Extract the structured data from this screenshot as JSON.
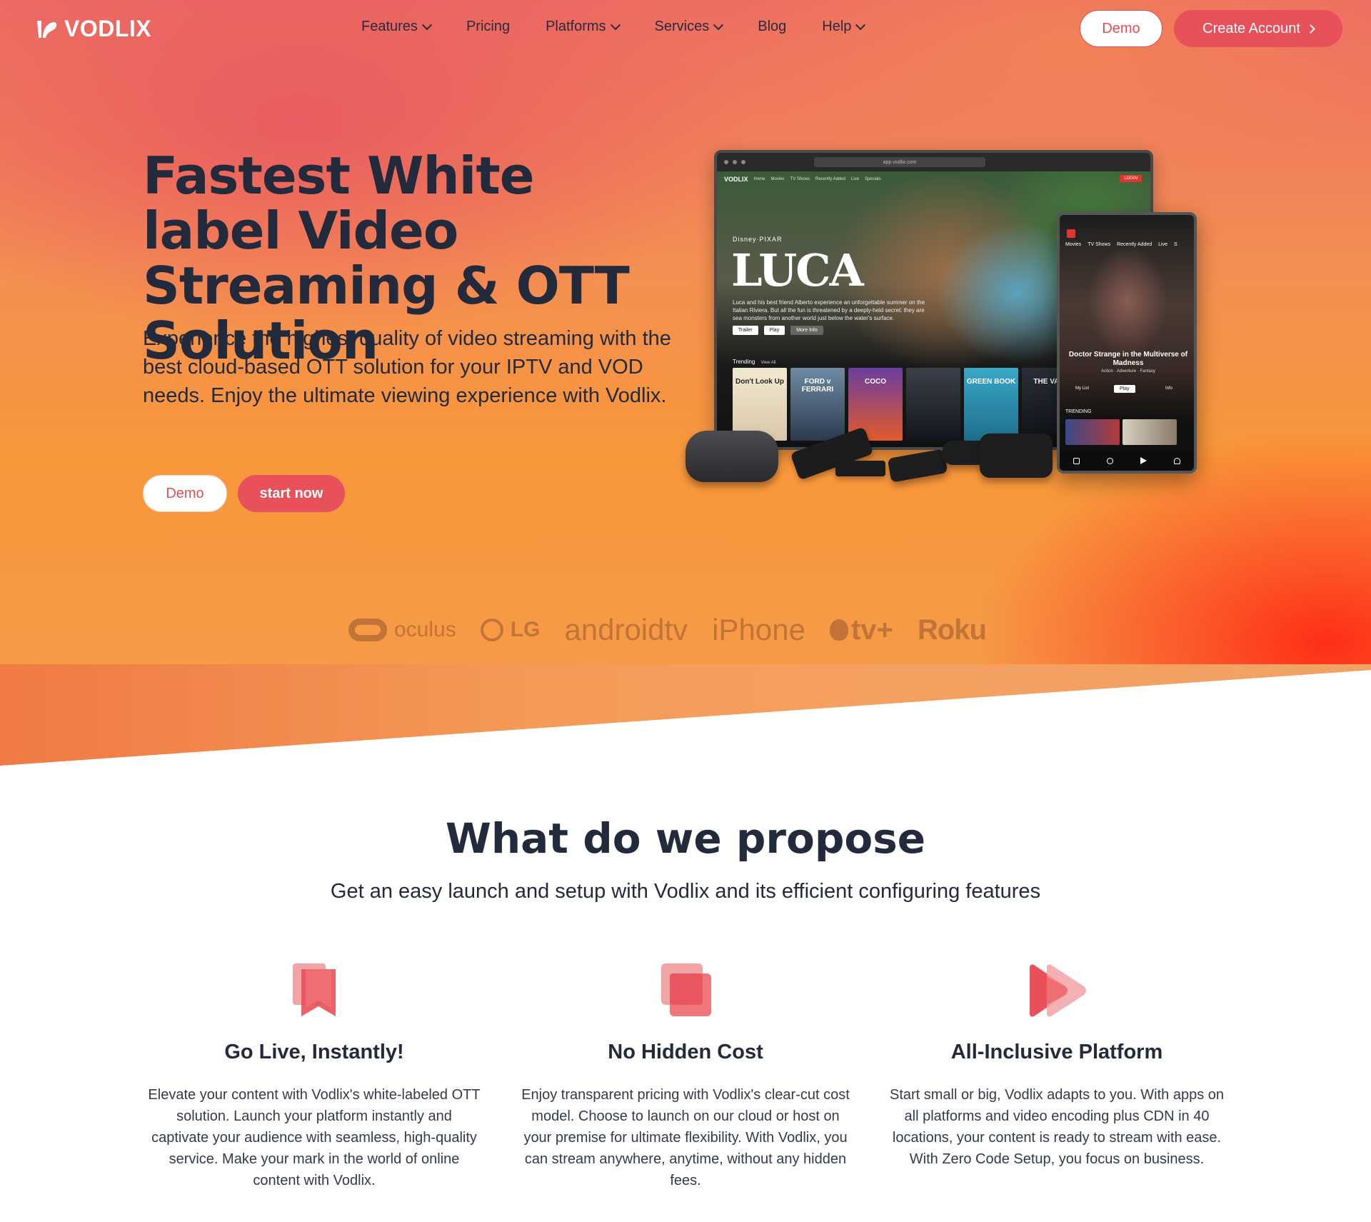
{
  "nav": {
    "brand": "VODLIX",
    "items": [
      {
        "label": "Features",
        "dropdown": true
      },
      {
        "label": "Pricing",
        "dropdown": false
      },
      {
        "label": "Platforms",
        "dropdown": true
      },
      {
        "label": "Services",
        "dropdown": true
      },
      {
        "label": "Blog",
        "dropdown": false
      },
      {
        "label": "Help",
        "dropdown": true
      }
    ],
    "demo_label": "Demo",
    "create_label": "Create Account"
  },
  "hero": {
    "title": "Fastest White label Video Streaming & OTT Solution",
    "subtitle": "Experience the highest quality of video streaming with the best cloud-based OTT solution for your IPTV and VOD needs. Enjoy the ultimate viewing experience with Vodlix.",
    "demo_label": "Demo",
    "start_label": "start now"
  },
  "mockup": {
    "url": "app.vodlix.com",
    "laptop_brand": "VODLIX",
    "laptop_nav": [
      "Home",
      "Movies",
      "TV Shows",
      "Recently Added",
      "Live",
      "Specials"
    ],
    "login": "LOGIN",
    "studio": "Disney·PIXAR",
    "feature_title": "LUCA",
    "feature_desc": "Luca and his best friend Alberto experience an unforgettable summer on the Italian Riviera. But all the fun is threatened by a deeply-held secret: they are sea monsters from another world just below the water's surface.",
    "buttons": [
      "Trailer",
      "Play",
      "More Info"
    ],
    "trending": "Trending",
    "view_all": "View All",
    "posters": [
      "Don't Look Up",
      "FORD v FERRARI",
      "COCO",
      "",
      "GREEN BOOK",
      "THE VAU"
    ],
    "tablet_nav": [
      "Movies",
      "TV Shows",
      "Recently Added",
      "Live",
      "S"
    ],
    "tablet_title": "Doctor Strange in the Multiverse of Madness",
    "tablet_genre": "Action · Adventure · Fantasy",
    "tablet_play": "Play",
    "tablet_mylist": "My List",
    "tablet_info": "Info",
    "tablet_trending": "TRENDING"
  },
  "platforms": [
    "oculus",
    "LG",
    "androidtv",
    "iPhone",
    "tv+",
    "Roku"
  ],
  "propose": {
    "title": "What do we propose",
    "subtitle": "Get an easy launch and setup with Vodlix and its efficient configuring features",
    "features": [
      {
        "icon": "bookmark-icon",
        "title": "Go Live, Instantly!",
        "text": "Elevate your content with Vodlix's white-labeled OTT solution. Launch your platform instantly and captivate your audience with seamless, high-quality service. Make your mark in the world of online content with Vodlix."
      },
      {
        "icon": "layers-icon",
        "title": "No Hidden Cost",
        "text": "Enjoy transparent pricing with Vodlix's clear-cut cost model. Choose to launch on our cloud or host on your premise for ultimate flexibility. With Vodlix, you can stream anywhere, anytime, without any hidden fees."
      },
      {
        "icon": "play-icon",
        "title": "All-Inclusive Platform",
        "text": "Start small or big, Vodlix adapts to you. With apps on all platforms and video encoding plus CDN in 40 locations, your content is ready to stream with ease. With Zero Code Setup, you focus on business."
      }
    ]
  },
  "colors": {
    "accent": "#e8505a",
    "text_dark": "#222a3b",
    "hero_orange": "#f8973a",
    "hero_red": "#ff2814"
  }
}
